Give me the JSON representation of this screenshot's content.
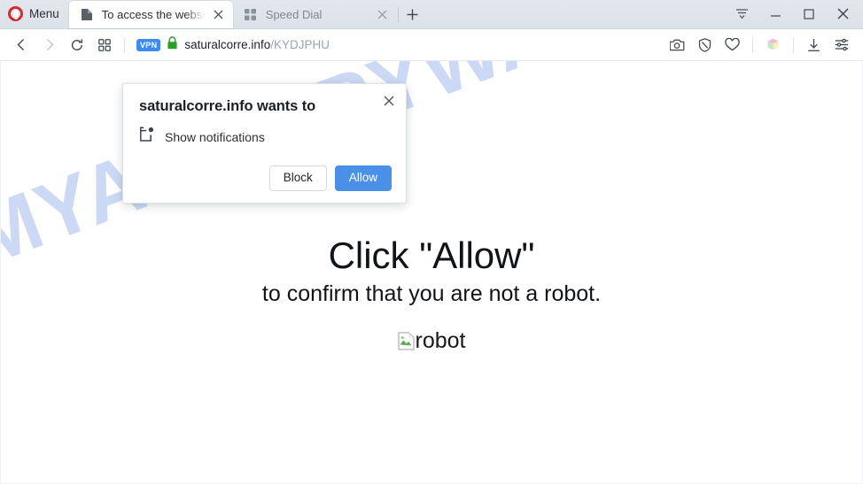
{
  "browser": {
    "menu_label": "Menu",
    "tabs": [
      {
        "title": "To access the website",
        "favicon": "page-icon",
        "active": true
      },
      {
        "title": "Speed Dial",
        "favicon": "grid-icon",
        "active": false
      }
    ],
    "new_tab_label": "+",
    "window_controls": {
      "tab_list": "tab-list-icon",
      "minimize": "minimize-icon",
      "maximize": "maximize-icon",
      "close": "close-icon"
    }
  },
  "toolbar": {
    "back": "back-arrow-icon",
    "forward": "forward-arrow-icon",
    "reload": "reload-icon",
    "speed_dial": "speed-dial-grid-icon",
    "vpn_badge": "VPN",
    "lock": "green-padlock-icon",
    "url_domain": "saturalcorre.info",
    "url_path": "/KYDJPHU",
    "right_icons": [
      "snapshot-camera-icon",
      "ad-blocker-shield-icon",
      "heart-icon",
      "extension-cube-icon",
      "downloads-icon",
      "easy-setup-sliders-icon"
    ]
  },
  "permission_dialog": {
    "title": "saturalcorre.info wants to",
    "permission_label": "Show notifications",
    "permission_icon": "notification-icon",
    "block_label": "Block",
    "allow_label": "Allow",
    "close_label": "×",
    "allow_color": "#4a90e8"
  },
  "page": {
    "watermark": "MYANTISPYWARE.COM",
    "watermark_color": "#ccd9f5",
    "headline": "Click \"Allow\"",
    "subline": "to confirm that you are not a robot.",
    "broken_image_alt": "robot"
  }
}
